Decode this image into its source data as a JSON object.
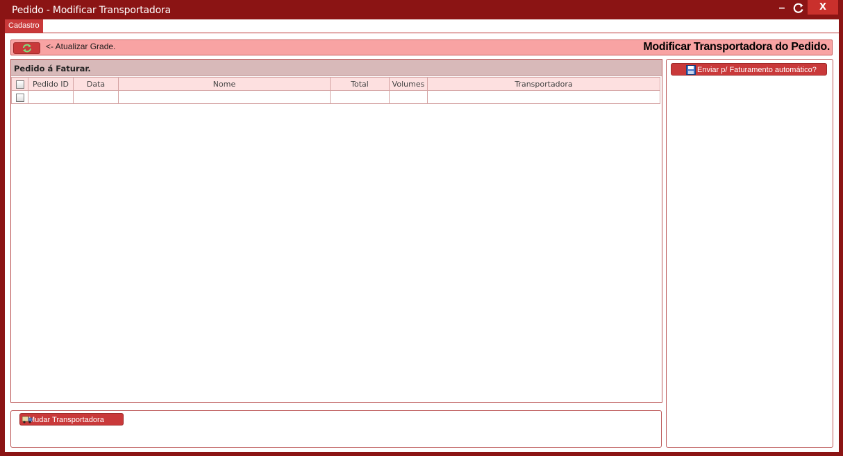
{
  "window": {
    "title": "Pedido - Modificar Transportadora",
    "minimize_label": "–",
    "close_label": "X"
  },
  "menu": {
    "items": [
      "Cadastro"
    ]
  },
  "toolbar": {
    "refresh_label": "<- Atualizar Grade.",
    "title": "Modificar Transportadora do Pedido."
  },
  "grid": {
    "caption": "Pedido á Faturar.",
    "columns": [
      "Pedido ID",
      "Data",
      "Nome",
      "Total",
      "Volumes",
      "Transportadora"
    ],
    "rows": [
      [
        "",
        "",
        "",
        "",
        "",
        ""
      ]
    ]
  },
  "actions": {
    "mudar_label": "Mudar Transportadora",
    "enviar_label": "Enviar p/ Faturamento automático?"
  },
  "colors": {
    "frame": "#8b1414",
    "accent": "#c9393a",
    "toolbar_bg": "#f8a3a3",
    "caption_bg": "#d8b9b9",
    "header_bg": "#fde0e0"
  }
}
